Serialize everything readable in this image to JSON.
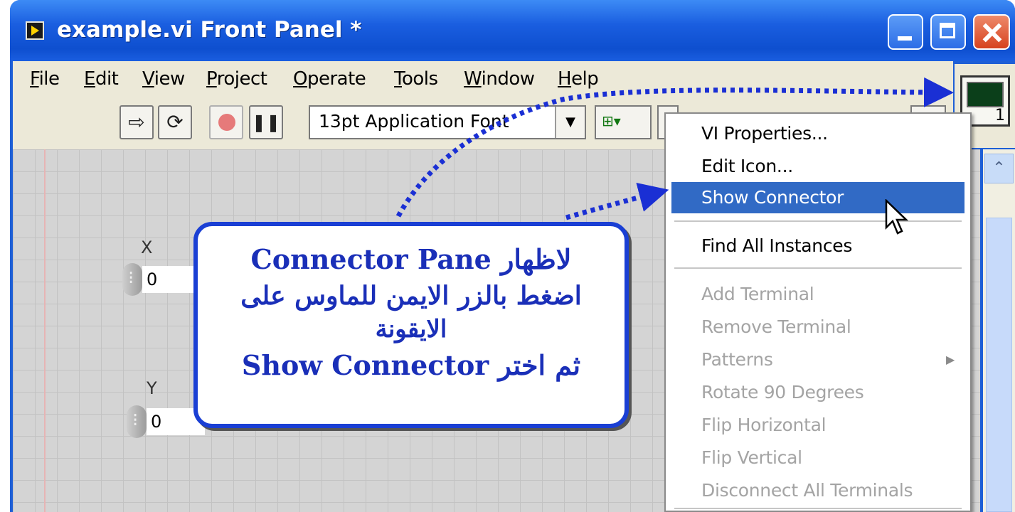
{
  "window": {
    "title": "example.vi Front Panel *"
  },
  "menubar": {
    "items": [
      {
        "pre": "",
        "u": "F",
        "post": "ile"
      },
      {
        "pre": "",
        "u": "E",
        "post": "dit"
      },
      {
        "pre": "",
        "u": "V",
        "post": "iew"
      },
      {
        "pre": "",
        "u": "P",
        "post": "roject"
      },
      {
        "pre": "",
        "u": "O",
        "post": "perate"
      },
      {
        "pre": "",
        "u": "T",
        "post": "ools"
      },
      {
        "pre": "",
        "u": "W",
        "post": "indow"
      },
      {
        "pre": "",
        "u": "H",
        "post": "elp"
      }
    ]
  },
  "toolbar": {
    "font_label": "13pt Application Font"
  },
  "icon_pane": {
    "terminal_number": "1"
  },
  "controls": {
    "x": {
      "label": "X",
      "value": "0"
    },
    "y": {
      "label": "Y",
      "value": "0"
    }
  },
  "callout": {
    "line1": "لاظهار Connector Pane",
    "line2": "اضغط بالزر الايمن للماوس على",
    "line3": "الايقونة",
    "line4": "ثم اختر Show Connector"
  },
  "context_menu": {
    "items": [
      {
        "label": "VI Properties...",
        "state": "enabled"
      },
      {
        "label": "Edit Icon...",
        "state": "enabled"
      },
      {
        "label": "Show Connector",
        "state": "selected"
      },
      {
        "label": "Find All Instances",
        "state": "enabled"
      },
      {
        "label": "Add Terminal",
        "state": "disabled"
      },
      {
        "label": "Remove Terminal",
        "state": "disabled"
      },
      {
        "label": "Patterns",
        "state": "disabled",
        "submenu": true
      },
      {
        "label": "Rotate 90 Degrees",
        "state": "disabled"
      },
      {
        "label": "Flip Horizontal",
        "state": "disabled"
      },
      {
        "label": "Flip Vertical",
        "state": "disabled"
      },
      {
        "label": "Disconnect All Terminals",
        "state": "disabled"
      }
    ]
  },
  "colors": {
    "title_bar": "#1a5ee0",
    "menu_highlight": "#316ac5",
    "callout_text": "#1a2fb8",
    "arrow_dots": "#1a2fd4"
  }
}
